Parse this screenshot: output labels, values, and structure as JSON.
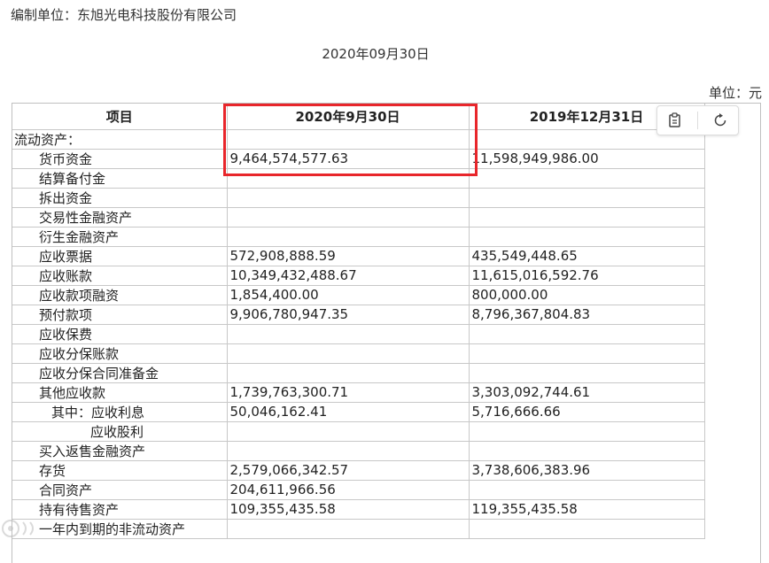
{
  "header": {
    "org": "编制单位：东旭光电科技股份有限公司",
    "date": "2020年09月30日",
    "unit": "单位：元"
  },
  "table": {
    "col_item": "项目",
    "col_cur": "2020年9月30日",
    "col_prev": "2019年12月31日",
    "rows": [
      {
        "label": "流动资产：",
        "cur": "",
        "prev": ""
      },
      {
        "label": "货币资金",
        "cur": "9,464,574,577.63",
        "prev": "11,598,949,986.00"
      },
      {
        "label": "结算备付金",
        "cur": "",
        "prev": ""
      },
      {
        "label": "拆出资金",
        "cur": "",
        "prev": ""
      },
      {
        "label": "交易性金融资产",
        "cur": "",
        "prev": ""
      },
      {
        "label": "衍生金融资产",
        "cur": "",
        "prev": ""
      },
      {
        "label": "应收票据",
        "cur": "572,908,888.59",
        "prev": "435,549,448.65"
      },
      {
        "label": "应收账款",
        "cur": "10,349,432,488.67",
        "prev": "11,615,016,592.76"
      },
      {
        "label": "应收款项融资",
        "cur": "1,854,400.00",
        "prev": "800,000.00"
      },
      {
        "label": "预付款项",
        "cur": "9,906,780,947.35",
        "prev": "8,796,367,804.83"
      },
      {
        "label": "应收保费",
        "cur": "",
        "prev": ""
      },
      {
        "label": "应收分保账款",
        "cur": "",
        "prev": ""
      },
      {
        "label": "应收分保合同准备金",
        "cur": "",
        "prev": ""
      },
      {
        "label": "其他应收款",
        "cur": "1,739,763,300.71",
        "prev": "3,303,092,744.61"
      },
      {
        "label": "其中：应收利息",
        "cur": "50,046,162.41",
        "prev": "5,716,666.66"
      },
      {
        "label": "应收股利",
        "cur": "",
        "prev": ""
      },
      {
        "label": "买入返售金融资产",
        "cur": "",
        "prev": ""
      },
      {
        "label": "存货",
        "cur": "2,579,066,342.57",
        "prev": "3,738,606,383.96"
      },
      {
        "label": "合同资产",
        "cur": "204,611,966.56",
        "prev": ""
      },
      {
        "label": "持有待售资产",
        "cur": "109,355,435.58",
        "prev": "119,355,435.58"
      },
      {
        "label": "一年内到期的非流动资产",
        "cur": "",
        "prev": ""
      }
    ]
  },
  "toolbar": {
    "copy_icon": "clipboard-icon",
    "refresh_icon": "refresh-icon"
  },
  "colors": {
    "highlight": "#e8262b",
    "border": "#c8c8c8"
  }
}
